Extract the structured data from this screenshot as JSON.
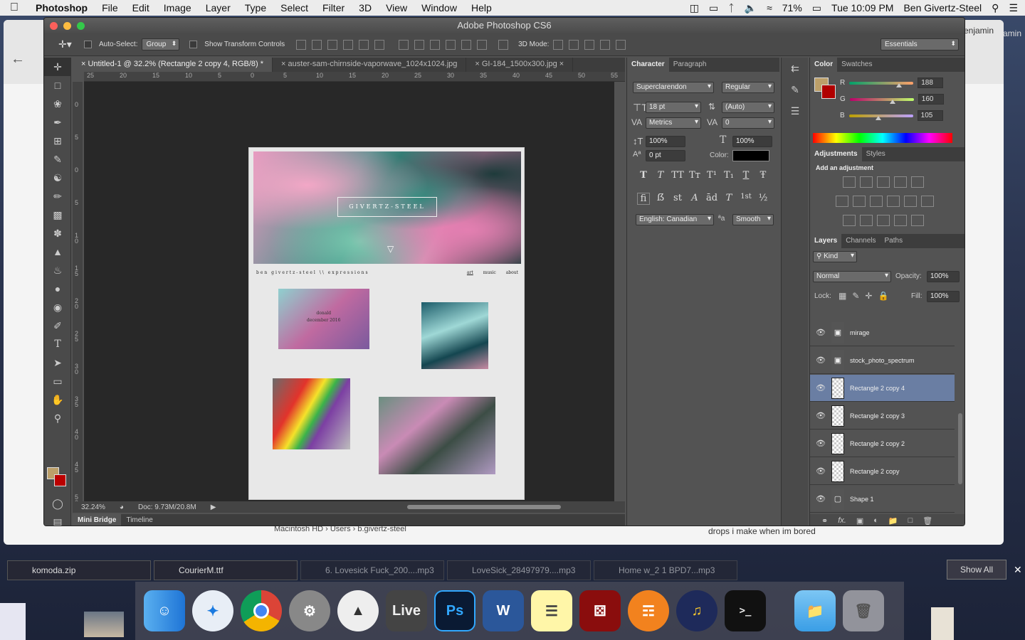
{
  "menubar": {
    "apple": "",
    "app_name": "Photoshop",
    "menus": [
      "File",
      "Edit",
      "Image",
      "Layer",
      "Type",
      "Select",
      "Filter",
      "3D",
      "View",
      "Window",
      "Help"
    ],
    "battery": "71%",
    "clock": "Tue 10:09 PM",
    "user": "Ben Givertz-Steel"
  },
  "background_window": {
    "user_partial_1": "enjamin",
    "user_partial_2": "amin",
    "footer_text": "drops i make when im bored",
    "path": "Macintosh HD  ›  Users  ›  b.givertz-steel"
  },
  "photoshop": {
    "title": "Adobe Photoshop CS6",
    "options": {
      "auto_select_label": "Auto-Select:",
      "auto_select_value": "Group",
      "show_transform_label": "Show Transform Controls",
      "mode3d_label": "3D Mode:",
      "workspace": "Essentials"
    },
    "doc_tabs": [
      "Untitled-1 @ 32.2% (Rectangle 2 copy 4, RGB/8) *",
      "auster-sam-chirnside-vaporwave_1024x1024.jpg",
      "GI-184_1500x300.jpg"
    ],
    "ruler_h": [
      "25",
      "20",
      "15",
      "10",
      "5",
      "0",
      "5",
      "10",
      "15",
      "20",
      "25",
      "30",
      "35",
      "40",
      "45",
      "50",
      "55"
    ],
    "ruler_v": [
      "0",
      "5",
      "0",
      "5",
      "1 0",
      "1 5",
      "2 0",
      "2 5",
      "3 0",
      "3 5",
      "4 0",
      "4 5",
      "5 0"
    ],
    "zoom": "32.24%",
    "doc_size": "Doc: 9.73M/20.8M",
    "bottom_tabs": [
      "Mini Bridge",
      "Timeline"
    ],
    "document": {
      "logo_text": "GIVERTZ-STEEL",
      "brand": "ben givertz-steel \\\\ expressions",
      "nav": [
        "art",
        "music",
        "about"
      ],
      "caption_line1": "donald",
      "caption_line2": "december 2016"
    }
  },
  "character": {
    "tabs": [
      "Character",
      "Paragraph"
    ],
    "font_family": "Superclarendon",
    "font_style": "Regular",
    "size": "18 pt",
    "leading": "(Auto)",
    "kerning": "Metrics",
    "tracking": "0",
    "vscale": "100%",
    "hscale": "100%",
    "baseline": "0 pt",
    "color_label": "Color:",
    "style_glyphs": [
      "T",
      "T",
      "TT",
      "Tт",
      "T¹",
      "T₁",
      "T",
      "Ŧ"
    ],
    "ot_glyphs": [
      "fi",
      "ẞ",
      "st",
      "A",
      "ād",
      "T",
      "1st",
      "½"
    ],
    "language": "English: Canadian",
    "aa_icon": "ªa",
    "antialias": "Smooth"
  },
  "color_panel": {
    "tabs": [
      "Color",
      "Swatches"
    ],
    "r_label": "R",
    "r": "188",
    "g_label": "G",
    "g": "160",
    "b_label": "B",
    "b": "105",
    "fg_color": "#bc9f69",
    "bg_color": "#b00000"
  },
  "adjustments": {
    "tabs": [
      "Adjustments",
      "Styles"
    ],
    "heading": "Add an adjustment"
  },
  "layers": {
    "tabs": [
      "Layers",
      "Channels",
      "Paths"
    ],
    "kind": "Kind",
    "blend": "Normal",
    "opacity_label": "Opacity:",
    "opacity": "100%",
    "lock_label": "Lock:",
    "fill_label": "Fill:",
    "fill": "100%",
    "items": [
      {
        "name": "mirage",
        "selected": false
      },
      {
        "name": "stock_photo_spectrum",
        "selected": false
      },
      {
        "name": "Rectangle 2 copy 4",
        "selected": true
      },
      {
        "name": "Rectangle 2 copy 3",
        "selected": false
      },
      {
        "name": "Rectangle 2 copy 2",
        "selected": false
      },
      {
        "name": "Rectangle 2 copy",
        "selected": false
      },
      {
        "name": "Shape 1",
        "selected": false
      }
    ]
  },
  "downloads": [
    "komoda.zip",
    "CourierM.ttf",
    "6. Lovesick Fuck_200....mp3",
    "LoveSick_28497979....mp3",
    "Home w_2 1 BPD7...mp3"
  ],
  "downloads_show_all": "Show All",
  "dock": {
    "live_label": "Live",
    "ps_label": "Ps",
    "word_label": "W"
  }
}
